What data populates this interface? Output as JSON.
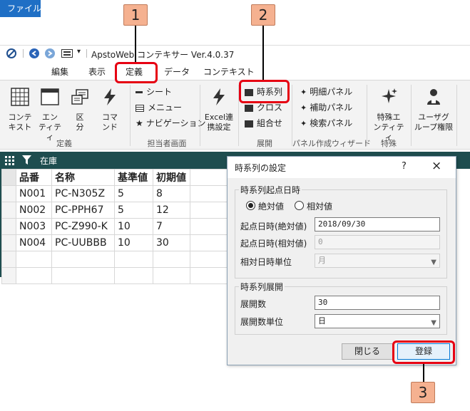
{
  "window": {
    "app_title": "ApstoWeb コンテキサー Ver.4.0.37"
  },
  "menu": {
    "items": [
      "ファイル",
      "編集",
      "表示",
      "定義",
      "データ",
      "コンテキスト"
    ],
    "active_index": 3
  },
  "ribbon": {
    "teigi": {
      "buttons": [
        "コンテ\nキスト",
        "エン\nティティ",
        "区\n分",
        "コマ\nンド"
      ],
      "label": "定義"
    },
    "tantou": {
      "items": [
        "シート",
        "メニュー",
        "ナビゲーション"
      ],
      "label": "担当者画面"
    },
    "excel": {
      "button": "Excel連\n携設定"
    },
    "tenkai": {
      "items": [
        "時系列",
        "クロス",
        "組合せ"
      ],
      "label": "展開"
    },
    "panel": {
      "items": [
        "明細パネル",
        "補助パネル",
        "検索パネル"
      ],
      "label": "パネル作成ウィザード"
    },
    "tokushu": {
      "button": "特殊エ\nンティティ",
      "label": "特殊"
    },
    "user": {
      "button": "ユーザグ\nループ権限"
    }
  },
  "grid": {
    "caption": "在庫",
    "columns": [
      "品番",
      "名称",
      "基準値",
      "初期値"
    ],
    "rows": [
      [
        "N001",
        "PC-N305Z",
        "5",
        "8"
      ],
      [
        "N002",
        "PC-PPH67",
        "5",
        "12"
      ],
      [
        "N003",
        "PC-Z990-K",
        "10",
        "7"
      ],
      [
        "N004",
        "PC-UUBBB",
        "10",
        "30"
      ]
    ]
  },
  "dialog": {
    "title": "時系列の設定",
    "help": "?",
    "close": "×",
    "start_group": {
      "title": "時系列起点日時",
      "radio_absolute": "絶対値",
      "radio_relative": "相対値",
      "selected": "絶対値",
      "abs_label": "起点日時(絶対値)",
      "abs_value": "2018/09/30",
      "rel_label": "起点日時(相対値)",
      "rel_value": "0",
      "unit_label": "相対日時単位",
      "unit_value": "月"
    },
    "expand_group": {
      "title": "時系列展開",
      "count_label": "展開数",
      "count_value": "30",
      "unit_label": "展開数単位",
      "unit_value": "日"
    },
    "close_button": "閉じる",
    "register_button": "登録"
  },
  "callouts": [
    "1",
    "2",
    "3"
  ],
  "colors": {
    "accent_blue": "#1f6fc5",
    "dark_strip": "#1e4d4f",
    "callout_fill": "#f5b190",
    "highlight_red": "#e60012"
  }
}
